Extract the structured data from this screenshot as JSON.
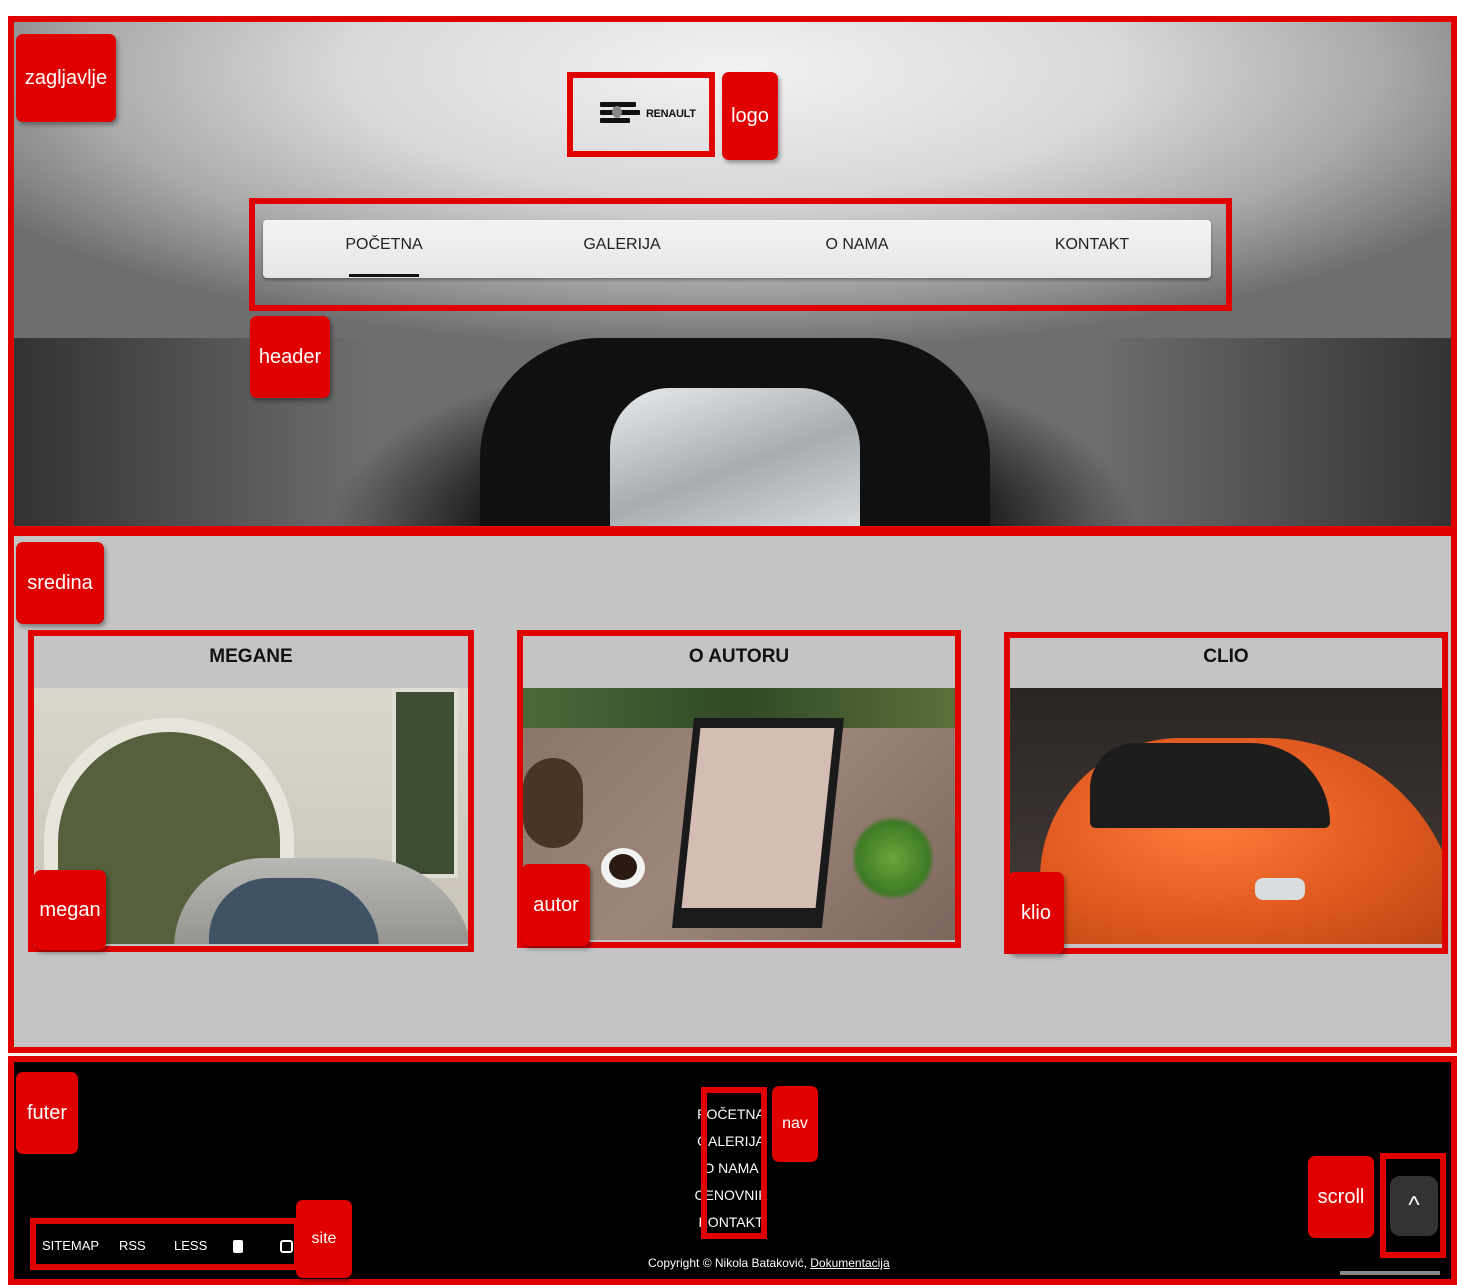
{
  "header": {
    "logo_text": "RENAULT",
    "nav": [
      "POČETNA",
      "GALERIJA",
      "O NAMA",
      "KONTAKT"
    ],
    "active_nav": "POČETNA"
  },
  "cards": [
    {
      "title": "MEGANE"
    },
    {
      "title": "O AUTORU"
    },
    {
      "title": "CLIO"
    }
  ],
  "footer": {
    "nav": [
      "POČETNA",
      "GALERIJA",
      "O NAMA",
      "CENOVNIK",
      "KONTAKT"
    ],
    "site_links": [
      "SITEMAP",
      "RSS",
      "LESS"
    ],
    "copyright": "Copyright © Nikola Bataković,",
    "doc_link": "Dokumentacija",
    "scroll_icon": "^"
  },
  "annotations": {
    "zagljavlje": "zagljavlje",
    "logo": "logo",
    "header": "header",
    "sredina": "sredina",
    "megan": "megan",
    "autor": "autor",
    "klio": "klio",
    "futer": "futer",
    "nav": "nav",
    "site": "site",
    "scroll": "scroll"
  },
  "colors": {
    "annotation_red": "#e00000",
    "middle_bg": "#c4c4c4",
    "footer_bg": "#000000"
  }
}
